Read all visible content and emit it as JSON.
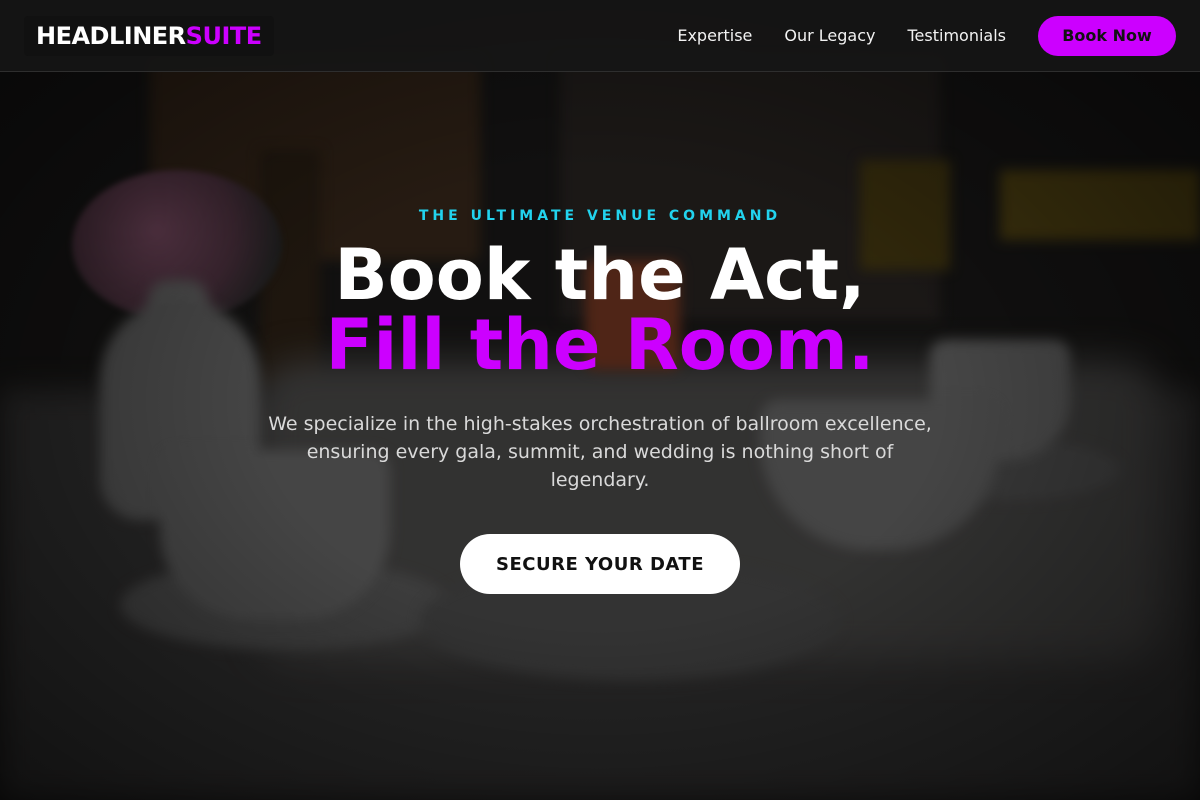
{
  "brand": {
    "name_part1": "HEADLINER",
    "name_part2": "SUITE",
    "accent_color": "#cc00ff",
    "eyebrow_color": "#22d3ee"
  },
  "nav": {
    "links": [
      {
        "label": "Expertise"
      },
      {
        "label": "Our Legacy"
      },
      {
        "label": "Testimonials"
      }
    ],
    "cta_label": "Book Now"
  },
  "hero": {
    "eyebrow": "THE ULTIMATE VENUE COMMAND",
    "title_line1": "Book the Act,",
    "title_line2": "Fill the Room.",
    "description": "We specialize in the high-stakes orchestration of ballroom excellence, ensuring every gala, summit, and wedding is nothing short of legendary.",
    "cta_label": "SECURE YOUR DATE"
  }
}
